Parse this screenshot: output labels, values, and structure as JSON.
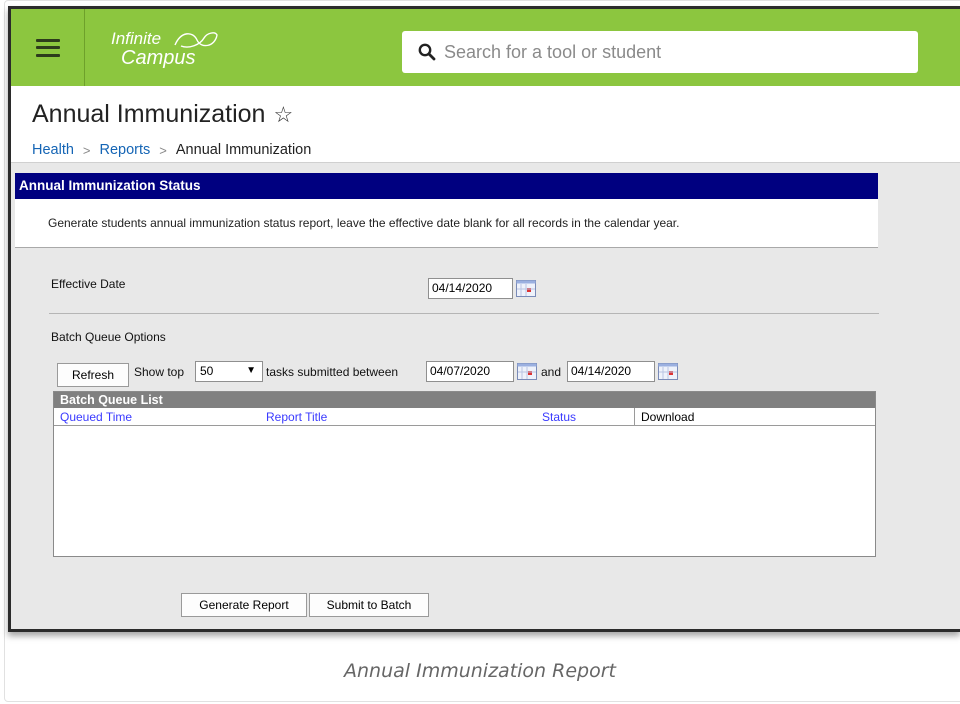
{
  "topbar": {
    "logo_line1": "Infinite",
    "logo_line2": "Campus",
    "search_placeholder": "Search for a tool or student",
    "accent_color": "#8cc63f"
  },
  "header": {
    "title": "Annual Immunization",
    "breadcrumb": [
      "Health",
      "Reports",
      "Annual Immunization"
    ]
  },
  "panel": {
    "heading": "Annual Immunization Status",
    "description": "Generate students annual immunization status report, leave the effective date blank for all records in the calendar year.",
    "effective_date_label": "Effective Date",
    "effective_date_value": "04/14/2020",
    "batch_options_label": "Batch Queue Options",
    "refresh_label": "Refresh",
    "show_top_label": "Show top",
    "show_top_value": "50",
    "tasks_between_label": "tasks submitted between",
    "start_date": "04/07/2020",
    "and_label": "and",
    "end_date": "04/14/2020"
  },
  "batch_queue": {
    "title": "Batch Queue List",
    "columns": [
      "Queued Time",
      "Report Title",
      "Status",
      "Download"
    ]
  },
  "actions": {
    "generate_label": "Generate Report",
    "submit_label": "Submit to Batch"
  },
  "caption": "Annual Immunization Report"
}
